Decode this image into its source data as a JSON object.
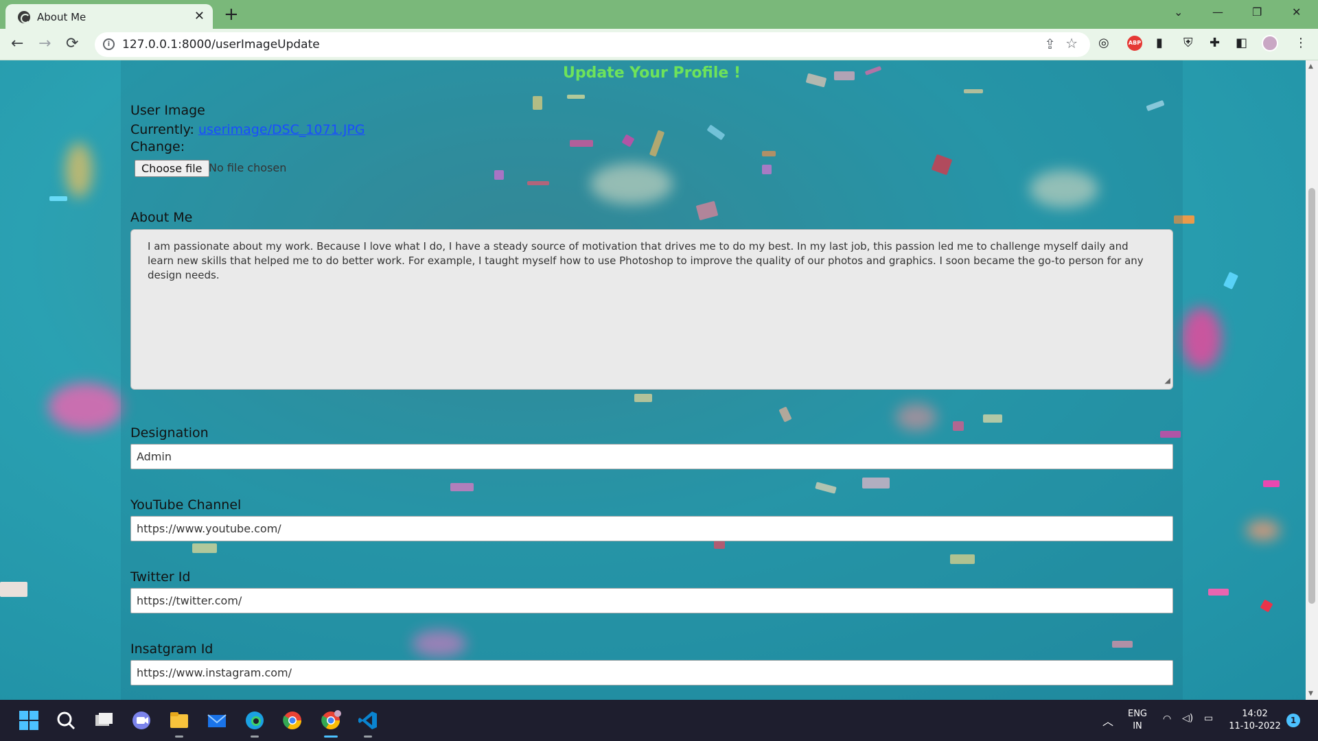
{
  "browser": {
    "tab_title": "About Me",
    "tab_close": "✕",
    "new_tab": "+",
    "url": "127.0.0.1:8000/userImageUpdate",
    "window_controls": {
      "dropdown": "⌄",
      "minimize": "—",
      "restore": "❐",
      "close": "✕"
    },
    "nav": {
      "back": "←",
      "forward": "→",
      "reload": "⟳"
    },
    "extensions": [
      "profile-scan-icon",
      "adblock-icon",
      "chart-icon",
      "vpn-icon",
      "puzzle-icon",
      "sidepanel-icon",
      "avatar"
    ],
    "abp_label": "ABP",
    "menu": "⋮"
  },
  "page": {
    "title": "Update Your Profile !",
    "user_image": {
      "label": "User Image",
      "currently_label": "Currently:",
      "current_file": "userimage/DSC_1071.JPG",
      "change_label": "Change:",
      "choose_button": "Choose file",
      "no_file": "No file chosen"
    },
    "about": {
      "label": "About Me",
      "text": "I am passionate about my work. Because I love what I do, I have a steady source of motivation that drives me to do my best. In my last job, this passion led me to challenge myself daily and learn new skills that helped me to do better work. For example, I taught myself how to use Photoshop to improve the quality of our photos and graphics. I soon became the go-to person for any design needs."
    },
    "designation": {
      "label": "Designation",
      "value": "Admin"
    },
    "youtube": {
      "label": "YouTube Channel",
      "value": "https://www.youtube.com/"
    },
    "twitter": {
      "label": "Twitter Id",
      "value": "https://twitter.com/"
    },
    "instagram": {
      "label": "Insatgram Id",
      "value": "https://www.instagram.com/"
    }
  },
  "taskbar": {
    "apps": [
      "start-icon",
      "search-icon",
      "taskview-icon",
      "teams-icon",
      "explorer-icon",
      "mail-icon",
      "edge-icon",
      "chrome-icon",
      "chrome-active-icon",
      "vscode-icon"
    ],
    "language": "ENG",
    "region": "IN",
    "time": "14:02",
    "date": "11-10-2022",
    "notification_count": "1",
    "tray_chevron": "︿"
  },
  "colors": {
    "tab_bar": "#7ab87a",
    "toolbar": "#e9f5e9",
    "title_green": "#6ee35a",
    "link_blue": "#1a4cff",
    "taskbar": "#1e1e2e"
  }
}
